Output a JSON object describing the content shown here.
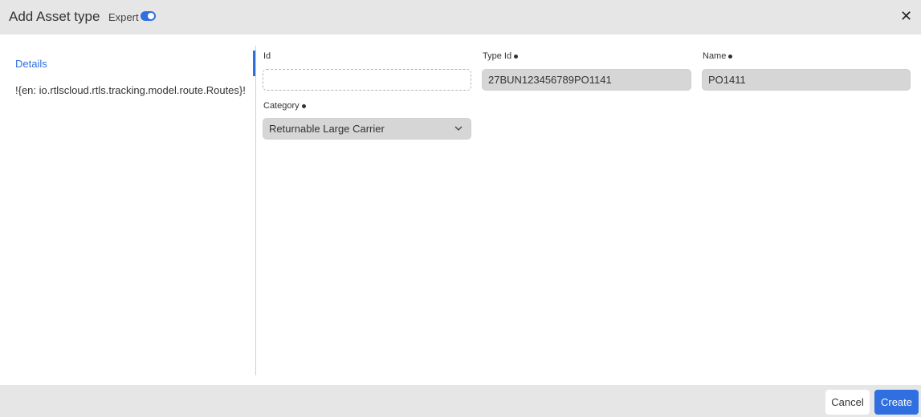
{
  "header": {
    "title": "Add Asset type",
    "expert_label": "Expert",
    "expert_enabled": true,
    "close_icon": "close-icon"
  },
  "sidebar": {
    "items": [
      {
        "label": "Details",
        "active": true
      }
    ],
    "text": "!{en: io.rtlscloud.rtls.tracking.model.route.Routes}!"
  },
  "form": {
    "id": {
      "label": "Id",
      "required": false,
      "value": ""
    },
    "type_id": {
      "label": "Type Id",
      "required": true,
      "value": "27BUN123456789PO1141"
    },
    "name": {
      "label": "Name",
      "required": true,
      "value": "PO1411"
    },
    "category": {
      "label": "Category",
      "required": true,
      "value": "Returnable Large Carrier"
    }
  },
  "footer": {
    "cancel_label": "Cancel",
    "create_label": "Create"
  },
  "colors": {
    "accent": "#2f6fe0",
    "header_bg": "#e6e6e6",
    "field_filled_bg": "#d6d6d6"
  }
}
